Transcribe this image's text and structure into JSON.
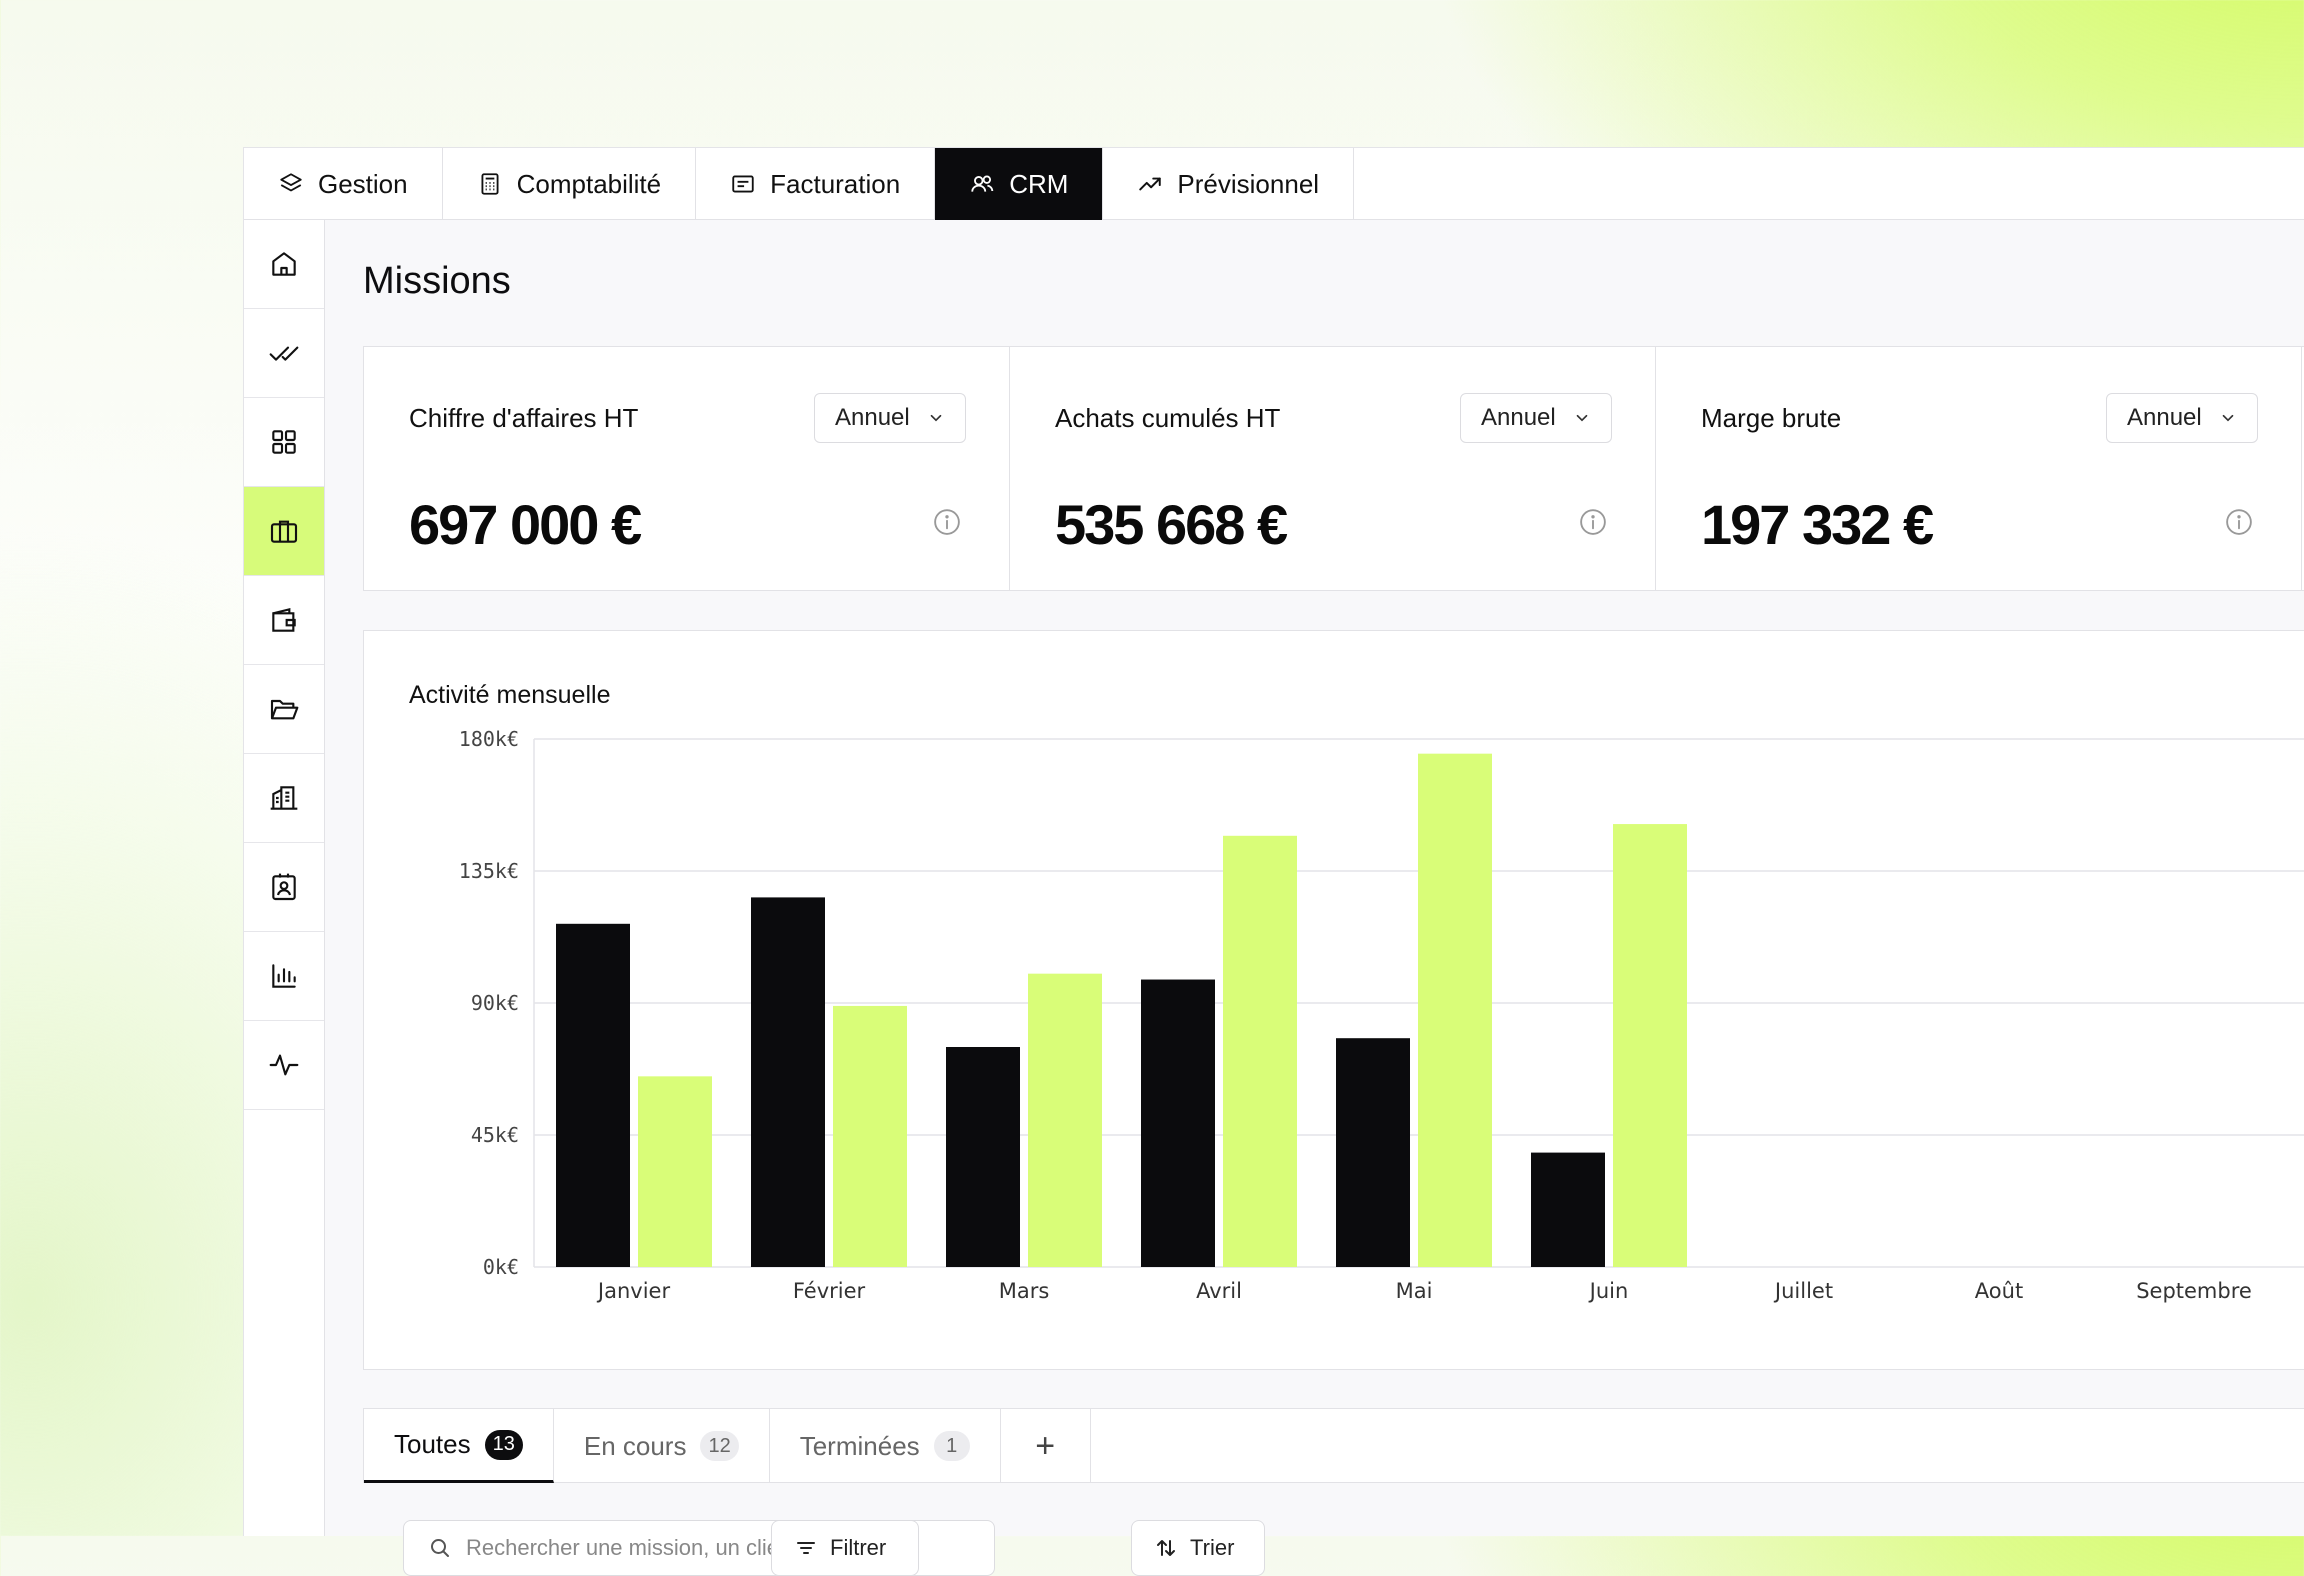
{
  "top_tabs": [
    {
      "label": "Gestion",
      "icon": "layers-icon"
    },
    {
      "label": "Comptabilité",
      "icon": "calculator-icon"
    },
    {
      "label": "Facturation",
      "icon": "invoice-icon"
    },
    {
      "label": "CRM",
      "icon": "users-icon",
      "active": true
    },
    {
      "label": "Prévisionnel",
      "icon": "trending-up-icon"
    }
  ],
  "sidebar": {
    "items": [
      {
        "icon": "home-icon"
      },
      {
        "icon": "double-check-icon"
      },
      {
        "icon": "grid-icon"
      },
      {
        "icon": "briefcase-icon",
        "active": true
      },
      {
        "icon": "wallet-icon"
      },
      {
        "icon": "folder-icon"
      },
      {
        "icon": "building-icon"
      },
      {
        "icon": "contact-card-icon"
      },
      {
        "icon": "bar-chart-icon"
      },
      {
        "icon": "activity-icon"
      }
    ]
  },
  "page": {
    "title": "Missions"
  },
  "kpis": [
    {
      "label": "Chiffre d'affaires HT",
      "period": "Annuel",
      "value": "697 000 €"
    },
    {
      "label": "Achats cumulés HT",
      "period": "Annuel",
      "value": "535 668 €"
    },
    {
      "label": "Marge brute",
      "period": "Annuel",
      "value": "197 332 €"
    }
  ],
  "chart": {
    "title": "Activité mensuelle"
  },
  "chart_data": {
    "type": "bar",
    "title": "Activité mensuelle",
    "categories": [
      "Janvier",
      "Février",
      "Mars",
      "Avril",
      "Mai",
      "Juin",
      "Juillet",
      "Août",
      "Septembre"
    ],
    "series": [
      {
        "color": "#0b0b0d",
        "values": [
          117000,
          126000,
          75000,
          98000,
          78000,
          39000,
          null,
          null,
          null
        ]
      },
      {
        "color": "#d9fd78",
        "values": [
          65000,
          89000,
          100000,
          147000,
          175000,
          151000,
          null,
          null,
          null
        ]
      }
    ],
    "ylim": [
      0,
      180000
    ],
    "yticks": [
      0,
      45000,
      90000,
      135000,
      180000
    ],
    "ytick_labels": [
      "0k€",
      "45k€",
      "90k€",
      "135k€",
      "180k€"
    ],
    "grid": true
  },
  "filter_tabs": [
    {
      "label": "Toutes",
      "count": "13",
      "active": true
    },
    {
      "label": "En cours",
      "count": "12"
    },
    {
      "label": "Terminées",
      "count": "1"
    }
  ],
  "add_tab": "+",
  "search": {
    "placeholder": "Rechercher une mission, un client"
  },
  "buttons": {
    "filter": "Filtrer",
    "sort": "Trier"
  },
  "colors": {
    "accent": "#d9fd78",
    "dark": "#0b0b0d"
  }
}
